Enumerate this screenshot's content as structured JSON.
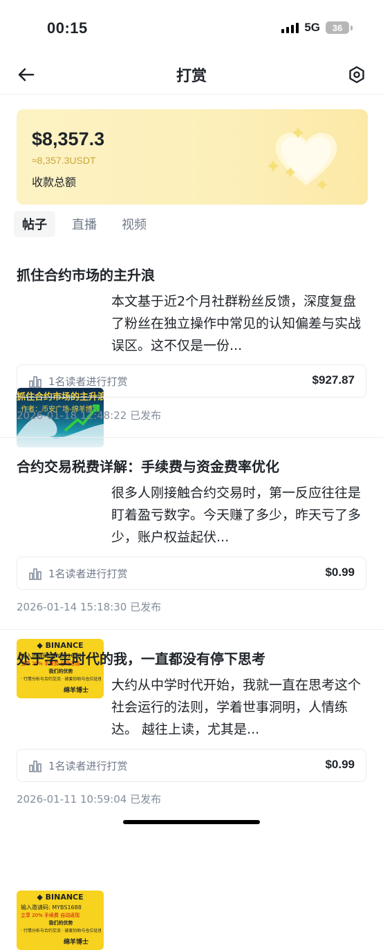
{
  "status_bar": {
    "time": "00:15",
    "network": "5G",
    "battery": "36"
  },
  "header": {
    "title": "打赏",
    "back_icon": "arrow-left-icon",
    "settings_icon": "hexagon-settings-icon"
  },
  "summary": {
    "amount": "$8,357.3",
    "amount_usdt": "≈8,357.3USDT",
    "label": "收款总额",
    "colors": {
      "card_start": "#fdf2c4",
      "card_end": "#fbe9a6",
      "usdt_text": "#c9a63a"
    }
  },
  "tabs": [
    {
      "label": "帖子",
      "active": true
    },
    {
      "label": "直播",
      "active": false
    },
    {
      "label": "视频",
      "active": false
    }
  ],
  "posts": [
    {
      "title": "抓住合约市场的主升浪",
      "excerpt": "本文基于近2个月社群粉丝反馈，深度复盘了粉丝在独立操作中常见的认知偏差与实战误区。这不仅是一份...",
      "thumbnail": {
        "style": "wave",
        "headline": "抓住合约市场的主升浪",
        "subline": "作者：币安广场-绵羊博士"
      },
      "readers": "1名读者进行打赏",
      "amount": "$927.87",
      "date": "2026-01-18 12:48:22 已发布"
    },
    {
      "title": "合约交易税费详解：手续费与资金费率优化",
      "excerpt": "很多人刚接触合约交易时，第一反应往往是盯着盈亏数字。今天赚了多少，昨天亏了多少，账户权益起伏...",
      "thumbnail": {
        "style": "binance",
        "brand": "BINANCE",
        "line1": "输入邀请码: MYBS1688",
        "line2": "立享 20% 手续费 自动返现",
        "line3": "我们的优势",
        "line4": "· 行情分析与合约交流  · 被套协助与仓位处理  · 专业级AI行情机器人  · 热议领域与互动共生",
        "signature": "绵羊博士"
      },
      "readers": "1名读者进行打赏",
      "amount": "$0.99",
      "date": "2026-01-14 15:18:30 已发布"
    },
    {
      "title": "处于学生时代的我，一直都没有停下思考",
      "excerpt": "大约从中学时代开始，我就一直在思考这个社会运行的法则，学着世事洞明，人情练达。 越往上读，尤其是...",
      "thumbnail": {
        "style": "binance",
        "brand": "BINANCE",
        "line1": "输入邀请码: MYBS1688",
        "line2": "立享 20% 手续费 自动返现",
        "line3": "我们的优势",
        "line4": "· 行情分析与合约交流  · 被套协助与仓位处理  · 专业级AI行情机器人  · 热议领域与互动共生",
        "signature": "绵羊博士"
      },
      "readers": "1名读者进行打赏",
      "amount": "$0.99",
      "date": "2026-01-11 10:59:04 已发布"
    }
  ]
}
